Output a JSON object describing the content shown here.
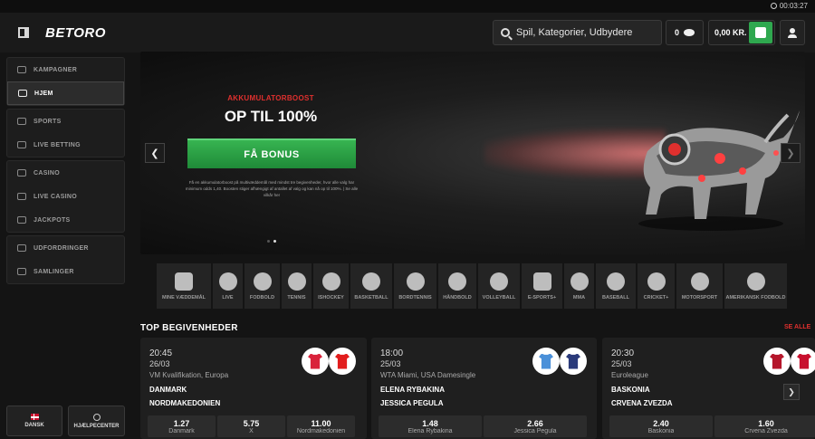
{
  "clock": {
    "time": "00:03:27"
  },
  "header": {
    "logo": "BETORO",
    "search_placeholder": "Spil, Kategorier, Udbydere",
    "coins": "0",
    "balance": "0,00 KR."
  },
  "sidebar": {
    "groups": [
      [
        {
          "label": "KAMPAGNER",
          "icon": "megaphone-icon"
        },
        {
          "label": "HJEM",
          "icon": "home-icon",
          "active": true
        }
      ],
      [
        {
          "label": "SPORTS",
          "icon": "ball-icon"
        },
        {
          "label": "LIVE BETTING",
          "icon": "live-icon"
        }
      ],
      [
        {
          "label": "CASINO",
          "icon": "slot-icon"
        },
        {
          "label": "LIVE CASINO",
          "icon": "dealer-icon"
        },
        {
          "label": "JACKPOTS",
          "icon": "jackpot-icon"
        }
      ],
      [
        {
          "label": "UDFORDRINGER",
          "icon": "challenge-icon"
        },
        {
          "label": "SAMLINGER",
          "icon": "collection-icon"
        }
      ]
    ],
    "language": "DANSK",
    "help": "HJÆLPECENTER"
  },
  "banner": {
    "kicker": "AKKUMULATORBOOST",
    "title": "OP TIL 100%",
    "button": "FÅ BONUS",
    "fine_print": "Få en akkumulatorboost på multivæddemål med mindst tre begivenheder, hvor alle valg har minimum odds 1,40. Boosten stiger afhængigt af antallet af valg og kan nå op til 100%. | Se alle vilkår her"
  },
  "sports": [
    {
      "label": "MINE VÆDDEMÅL",
      "icon": "ticket-icon",
      "w": 60
    },
    {
      "label": "LIVE",
      "icon": "play-icon",
      "w": 33
    },
    {
      "label": "FODBOLD",
      "icon": "football-icon",
      "w": 39
    },
    {
      "label": "TENNIS",
      "icon": "tennis-icon",
      "w": 33
    },
    {
      "label": "ISHOCKEY",
      "icon": "hockey-icon",
      "w": 39
    },
    {
      "label": "BASKETBALL",
      "icon": "basketball-icon",
      "w": 46
    },
    {
      "label": "BORDTENNIS",
      "icon": "table-tennis-icon",
      "w": 47
    },
    {
      "label": "HÅNDBOLD",
      "icon": "handball-icon",
      "w": 42
    },
    {
      "label": "VOLLEYBALL",
      "icon": "volleyball-icon",
      "w": 46
    },
    {
      "label": "E-SPORTS+",
      "icon": "gamepad-icon",
      "w": 45
    },
    {
      "label": "MMA",
      "icon": "glove-icon",
      "w": 33
    },
    {
      "label": "BASEBALL",
      "icon": "baseball-icon",
      "w": 44
    },
    {
      "label": "CRICKET+",
      "icon": "cricket-icon",
      "w": 41
    },
    {
      "label": "MOTORSPORT",
      "icon": "helmet-icon",
      "w": 51
    },
    {
      "label": "AMERIKANSK FODBOLD",
      "icon": "football-helmet-icon",
      "w": 69
    }
  ],
  "top_events": {
    "title": "TOP BEGIVENHEDER",
    "see_all": "SE ALLE",
    "events": [
      {
        "time": "20:45",
        "date": "26/03",
        "league": "VM Kvalifikation, Europa",
        "team1": "DANMARK",
        "team2": "NORDMAKEDONIEN",
        "kit1": "#d9223b",
        "kit2": "#e21d1d",
        "odds": [
          {
            "v": "1.27",
            "l": "Danmark"
          },
          {
            "v": "5.75",
            "l": "X"
          },
          {
            "v": "11.00",
            "l": "Nordmakedonien"
          }
        ]
      },
      {
        "time": "18:00",
        "date": "25/03",
        "league": "WTA Miami, USA Damesingle",
        "team1": "ELENA RYBAKINA",
        "team2": "JESSICA PEGULA",
        "kit1": "#4a90d9",
        "kit2": "#2a3a7a",
        "odds": [
          {
            "v": "1.48",
            "l": "Elena Rybakina"
          },
          {
            "v": "2.66",
            "l": "Jessica Pegula"
          }
        ]
      },
      {
        "time": "20:30",
        "date": "25/03",
        "league": "Euroleague",
        "team1": "BASKONIA",
        "team2": "CRVENA ZVEZDA",
        "kit1": "#b5162b",
        "kit2": "#c8102e",
        "odds": [
          {
            "v": "2.40",
            "l": "Baskonia"
          },
          {
            "v": "1.60",
            "l": "Crvena Zvezda"
          }
        ]
      }
    ]
  }
}
